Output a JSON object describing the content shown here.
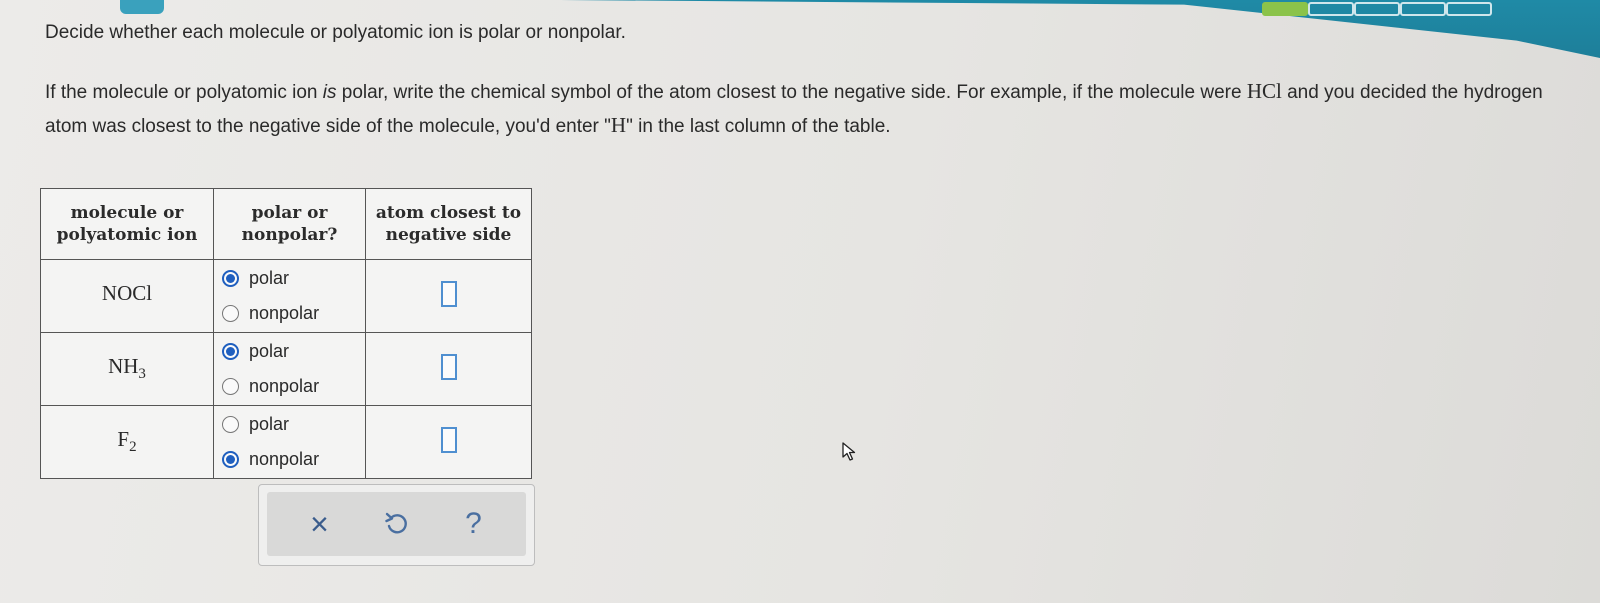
{
  "instructions": {
    "line1": "Decide whether each molecule or polyatomic ion is polar or nonpolar.",
    "line2_part1": "If the molecule or polyatomic ion ",
    "line2_italic": "is",
    "line2_part2": " polar, write the chemical symbol of the atom closest to the negative side. For example, if the molecule were ",
    "example_formula": "HCl",
    "line2_part3": " and you decided the hydrogen atom was closest to the negative side of the molecule, you'd enter \"",
    "example_symbol": "H",
    "line2_part4": "\" in the last column of the table."
  },
  "table": {
    "headers": [
      "molecule or polyatomic ion",
      "polar or nonpolar?",
      "atom closest to negative side"
    ],
    "rows": [
      {
        "formula": "NOCl",
        "subscript": "",
        "polar_label": "polar",
        "nonpolar_label": "nonpolar",
        "selected": "polar",
        "answer": ""
      },
      {
        "formula": "NH",
        "subscript": "3",
        "polar_label": "polar",
        "nonpolar_label": "nonpolar",
        "selected": "polar",
        "answer": ""
      },
      {
        "formula": "F",
        "subscript": "2",
        "polar_label": "polar",
        "nonpolar_label": "nonpolar",
        "selected": "nonpolar",
        "answer": ""
      }
    ]
  },
  "actions": {
    "clear_icon": "x-icon",
    "undo_icon": "undo-icon",
    "help_icon": "help-icon",
    "clear_glyph": "×",
    "help_glyph": "?"
  },
  "colors": {
    "accent": "#1f5fbf",
    "teal": "#1f8aa6",
    "progress_done": "#8bc34a"
  },
  "progress": {
    "completed": 1,
    "total": 5
  }
}
